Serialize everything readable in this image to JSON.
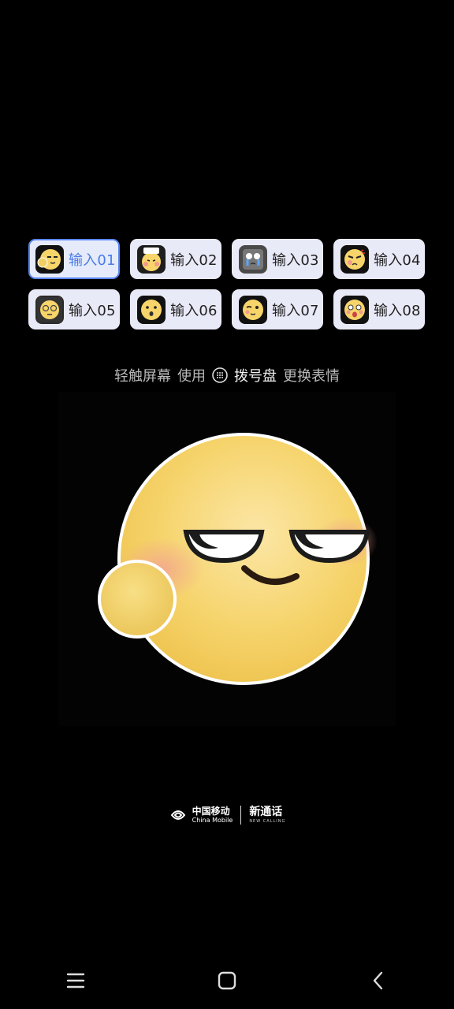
{
  "chips": [
    {
      "label": "输入01",
      "emoji": "smug"
    },
    {
      "label": "输入02",
      "emoji": "blush-sign"
    },
    {
      "label": "输入03",
      "emoji": "crying-robot"
    },
    {
      "label": "输入04",
      "emoji": "angry"
    },
    {
      "label": "输入05",
      "emoji": "glasses"
    },
    {
      "label": "输入06",
      "emoji": "surprised"
    },
    {
      "label": "输入07",
      "emoji": "wink"
    },
    {
      "label": "输入08",
      "emoji": "shocked"
    }
  ],
  "selected_chip": "输入01",
  "hint": {
    "part1": "轻触屏幕",
    "part2": "使用",
    "dialpad": "拨号盘",
    "part3": "更换表情"
  },
  "brand": {
    "operator_cn": "中国移动",
    "operator_en": "China Mobile",
    "service_cn": "新通话",
    "service_en": "NEW CALLING"
  },
  "colors": {
    "accent": "#5a86f0",
    "chip_bg": "#e9eaf7",
    "emoji_yellow": "#f7d56a"
  }
}
